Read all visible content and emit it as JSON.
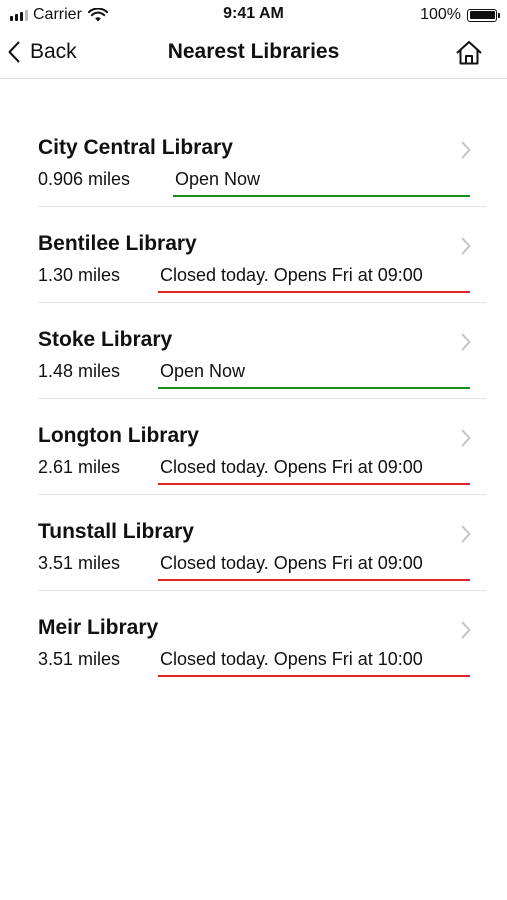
{
  "status_bar": {
    "carrier": "Carrier",
    "time": "9:41 AM",
    "battery": "100%",
    "battery_level": 1.0
  },
  "nav": {
    "back_label": "Back",
    "title": "Nearest Libraries",
    "back_icon": "chevron-left-icon",
    "home_icon": "home-icon"
  },
  "colors": {
    "open": "#1a8a1a",
    "closed": "#e0262a",
    "divider": "#e4e4e4"
  },
  "libraries": [
    {
      "name": "City Central Library",
      "distance": "0.906 miles",
      "status": "Open Now",
      "state": "open"
    },
    {
      "name": "Bentilee Library",
      "distance": "1.30 miles",
      "status": "Closed today. Opens Fri at 09:00",
      "state": "closed"
    },
    {
      "name": "Stoke Library",
      "distance": "1.48 miles",
      "status": "Open Now",
      "state": "open"
    },
    {
      "name": "Longton Library",
      "distance": "2.61 miles",
      "status": "Closed today. Opens Fri at 09:00",
      "state": "closed"
    },
    {
      "name": "Tunstall Library",
      "distance": "3.51 miles",
      "status": "Closed today. Opens Fri at 09:00",
      "state": "closed"
    },
    {
      "name": "Meir Library",
      "distance": "3.51 miles",
      "status": "Closed today. Opens Fri at 10:00",
      "state": "closed"
    }
  ]
}
